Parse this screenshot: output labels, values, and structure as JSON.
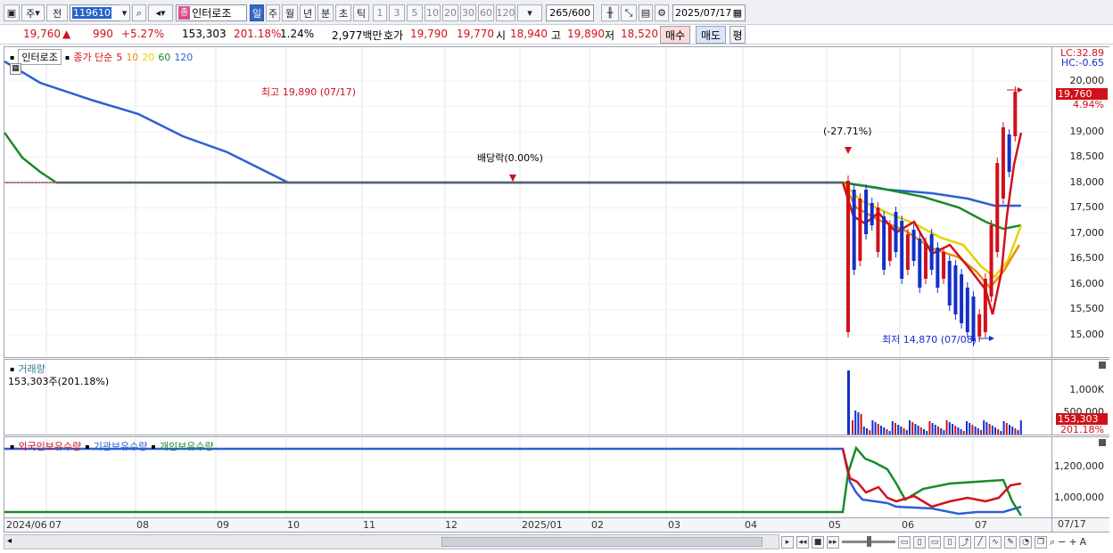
{
  "toolbar": {
    "mode_ju": "주",
    "mode_jeon": "전",
    "code": "119610",
    "badge": "종",
    "name": "인터로조",
    "periods": [
      "일",
      "주",
      "월",
      "년",
      "분",
      "초",
      "틱"
    ],
    "active_period": "일",
    "intervals": [
      "1",
      "3",
      "5",
      "10",
      "20",
      "30",
      "60",
      "120"
    ],
    "count": "265/600",
    "date": "2025/07/17"
  },
  "quote": {
    "price": "19,760",
    "change": "990",
    "change_pct": "+5.27%",
    "volume": "153,303",
    "volume_ratio": "201.18%",
    "turnover": "1.24%",
    "amount": "2,977백만",
    "hoga_label": "호가",
    "ask": "19,790",
    "bid": "19,770",
    "open_label": "시",
    "open": "18,940",
    "high_label": "고",
    "high": "19,890",
    "low_label": "저",
    "low": "18,520",
    "buy": "매수",
    "sell": "매도",
    "eval": "평"
  },
  "price_panel": {
    "stock_name": "인터로조",
    "series_label": "종가 단순",
    "ma": [
      {
        "label": "5",
        "color": "#d0111a"
      },
      {
        "label": "10",
        "color": "#f08a00"
      },
      {
        "label": "20",
        "color": "#e6d200"
      },
      {
        "label": "60",
        "color": "#1b8a2a"
      },
      {
        "label": "120",
        "color": "#2d5fd6"
      }
    ],
    "lc": "LC:32.89",
    "hc": "HC:-0.65",
    "y_ticks": [
      "20,000",
      "19,500",
      "19,000",
      "18,500",
      "18,000",
      "17,500",
      "17,000",
      "16,500",
      "16,000",
      "15,500",
      "15,000"
    ],
    "current_price_tag": "19,760",
    "current_pct_tag": "4.94%",
    "high_note": "최고 19,890 (07/17)",
    "low_note": "최저 14,870 (07/08)",
    "dividend_note": "배당락(0.00%)",
    "split_note": "(-27.71%)"
  },
  "volume_panel": {
    "title": "거래량",
    "value": "153,303주(201.18%)",
    "y_ticks": [
      "1,000K",
      "500,000"
    ],
    "current_tag": "153,303",
    "current_pct_tag": "201.18%"
  },
  "holding_panel": {
    "foreign": "외국인보유수량",
    "inst": "기관보유수량",
    "indiv": "개인보유수량",
    "y_ticks": [
      "1,200,000",
      "1,000,000"
    ]
  },
  "date_axis": {
    "labels": [
      "2024/06",
      "07",
      "08",
      "09",
      "10",
      "11",
      "12",
      "2025/01",
      "02",
      "03",
      "04",
      "05",
      "06",
      "07"
    ],
    "right": "07/17"
  },
  "colors": {
    "up": "#d0111a",
    "down": "#1330c8",
    "ma5": "#d0111a",
    "ma10": "#f08a00",
    "ma20": "#e6d200",
    "ma60": "#1b8a2a",
    "ma120": "#2d5fd6"
  }
}
